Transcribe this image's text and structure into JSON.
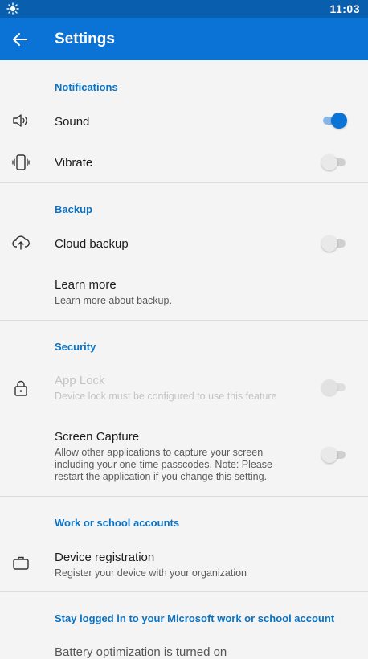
{
  "status_bar": {
    "time": "11:03",
    "icon": "sun-icon"
  },
  "app_bar": {
    "title": "Settings",
    "back_icon": "arrow-left-icon"
  },
  "colors": {
    "status_bar": "#0a5eae",
    "app_bar": "#0b73d6",
    "accent": "#0b73c4",
    "background": "#f4f4f4"
  },
  "sections": {
    "notifications": {
      "header": "Notifications",
      "sound": {
        "title": "Sound",
        "icon": "speaker-icon",
        "enabled": true
      },
      "vibrate": {
        "title": "Vibrate",
        "icon": "phone-vibrate-icon",
        "enabled": false
      }
    },
    "backup": {
      "header": "Backup",
      "cloud_backup": {
        "title": "Cloud backup",
        "icon": "cloud-upload-icon",
        "enabled": false
      },
      "learn_more": {
        "title": "Learn more",
        "subtitle": "Learn more about backup."
      }
    },
    "security": {
      "header": "Security",
      "app_lock": {
        "title": "App Lock",
        "subtitle": "Device lock must be configured to use this feature",
        "icon": "lock-icon",
        "enabled": false,
        "disabled": true
      },
      "screen_capture": {
        "title": "Screen Capture",
        "subtitle_line1": "Allow other applications to capture your screen",
        "subtitle_line2": "including your one-time passcodes. Note: Please",
        "subtitle_line3": "restart the application if you change this setting.",
        "enabled": false
      }
    },
    "work_accounts": {
      "header": "Work or school accounts",
      "device_registration": {
        "title": "Device registration",
        "subtitle": "Register your device with your organization",
        "icon": "briefcase-icon"
      }
    },
    "stay_logged_in": {
      "header": "Stay logged in to your Microsoft work or school account",
      "battery": {
        "title": "Battery optimization is turned on"
      }
    }
  }
}
